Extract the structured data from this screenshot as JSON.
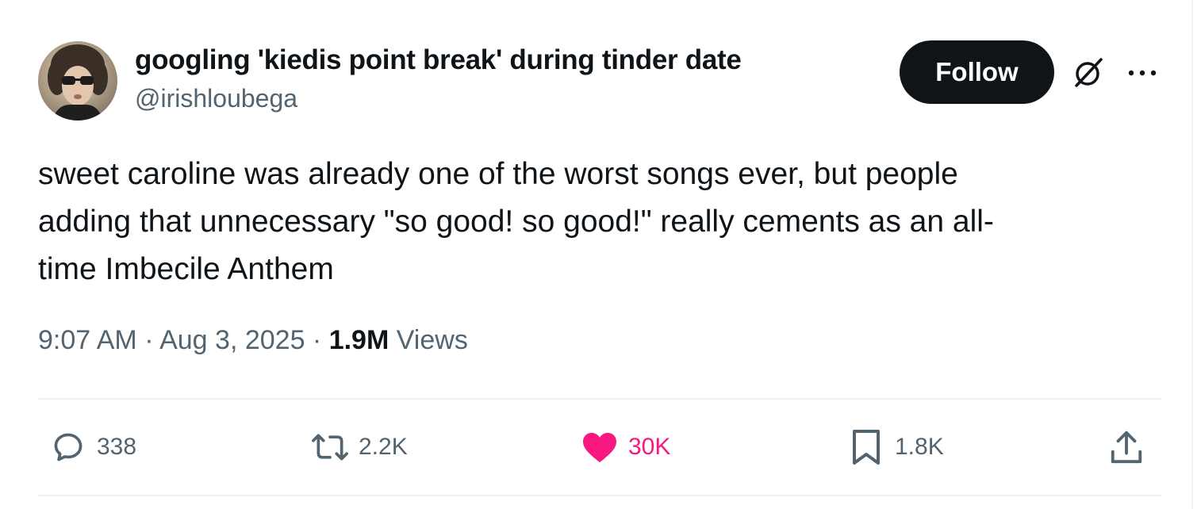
{
  "author": {
    "display_name": "googling 'kiedis point break' during tinder date",
    "handle": "@irishloubega"
  },
  "header": {
    "follow_label": "Follow",
    "grok_icon": "grok-icon",
    "more_icon": "more-icon"
  },
  "tweet": {
    "text": "sweet caroline was already one of the worst songs ever, but people\nadding that unnecessary \"so good! so good!\" really cements as an all-\ntime Imbecile Anthem"
  },
  "meta": {
    "time": "9:07 AM",
    "separator": " · ",
    "date": "Aug 3, 2025",
    "views_count": "1.9M",
    "views_label": " Views"
  },
  "actions": {
    "reply": {
      "icon": "reply-icon",
      "count": "338"
    },
    "retweet": {
      "icon": "retweet-icon",
      "count": "2.2K"
    },
    "like": {
      "icon": "heart-icon",
      "count": "30K",
      "color": "#f91880"
    },
    "bookmark": {
      "icon": "bookmark-icon",
      "count": "1.8K"
    },
    "share": {
      "icon": "share-icon"
    }
  },
  "colors": {
    "text_primary": "#0f1419",
    "text_secondary": "#536471",
    "like_accent": "#f91880",
    "divider": "#eff3f4",
    "follow_button_bg": "#0f1419"
  }
}
